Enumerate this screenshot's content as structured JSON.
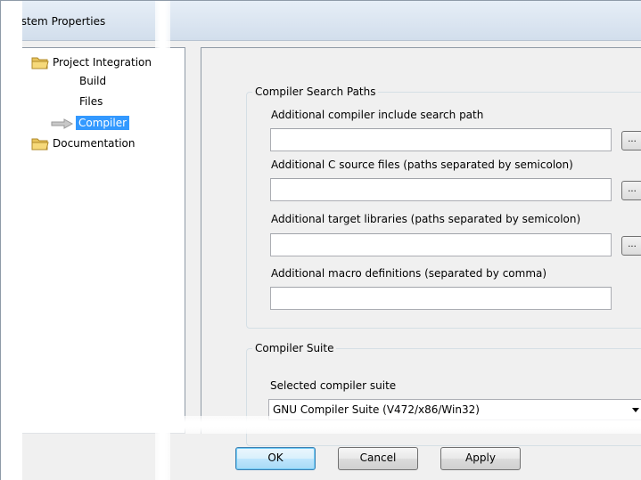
{
  "window": {
    "title": "System Properties"
  },
  "tree": {
    "items": [
      {
        "label": "Project Integration",
        "icon": "folder-icon"
      },
      {
        "label": "Build"
      },
      {
        "label": "Files"
      },
      {
        "label": "Compiler",
        "icon": "arrow-icon",
        "selected": true
      },
      {
        "label": "Documentation",
        "icon": "folder-icon"
      }
    ]
  },
  "search_paths": {
    "group_label": "Compiler Search Paths",
    "include_label": "Additional compiler include search path",
    "include_value": "",
    "c_source_label": "Additional C source files (paths separated by semicolon)",
    "c_source_value": "",
    "libraries_label": "Additional target libraries (paths separated by semicolon)",
    "libraries_value": "",
    "macros_label": "Additional macro definitions (separated by comma)",
    "macros_value": "",
    "browse_label": "..."
  },
  "compiler_suite": {
    "group_label": "Compiler Suite",
    "selected_label": "Selected compiler suite",
    "selected_value": "GNU Compiler Suite (V472/x86/Win32)"
  },
  "buttons": {
    "ok": "OK",
    "cancel": "Cancel",
    "apply": "Apply"
  },
  "colors": {
    "selection": "#3399ff",
    "titlebar": "#d8e3ef",
    "panel": "#f0f0f0"
  }
}
